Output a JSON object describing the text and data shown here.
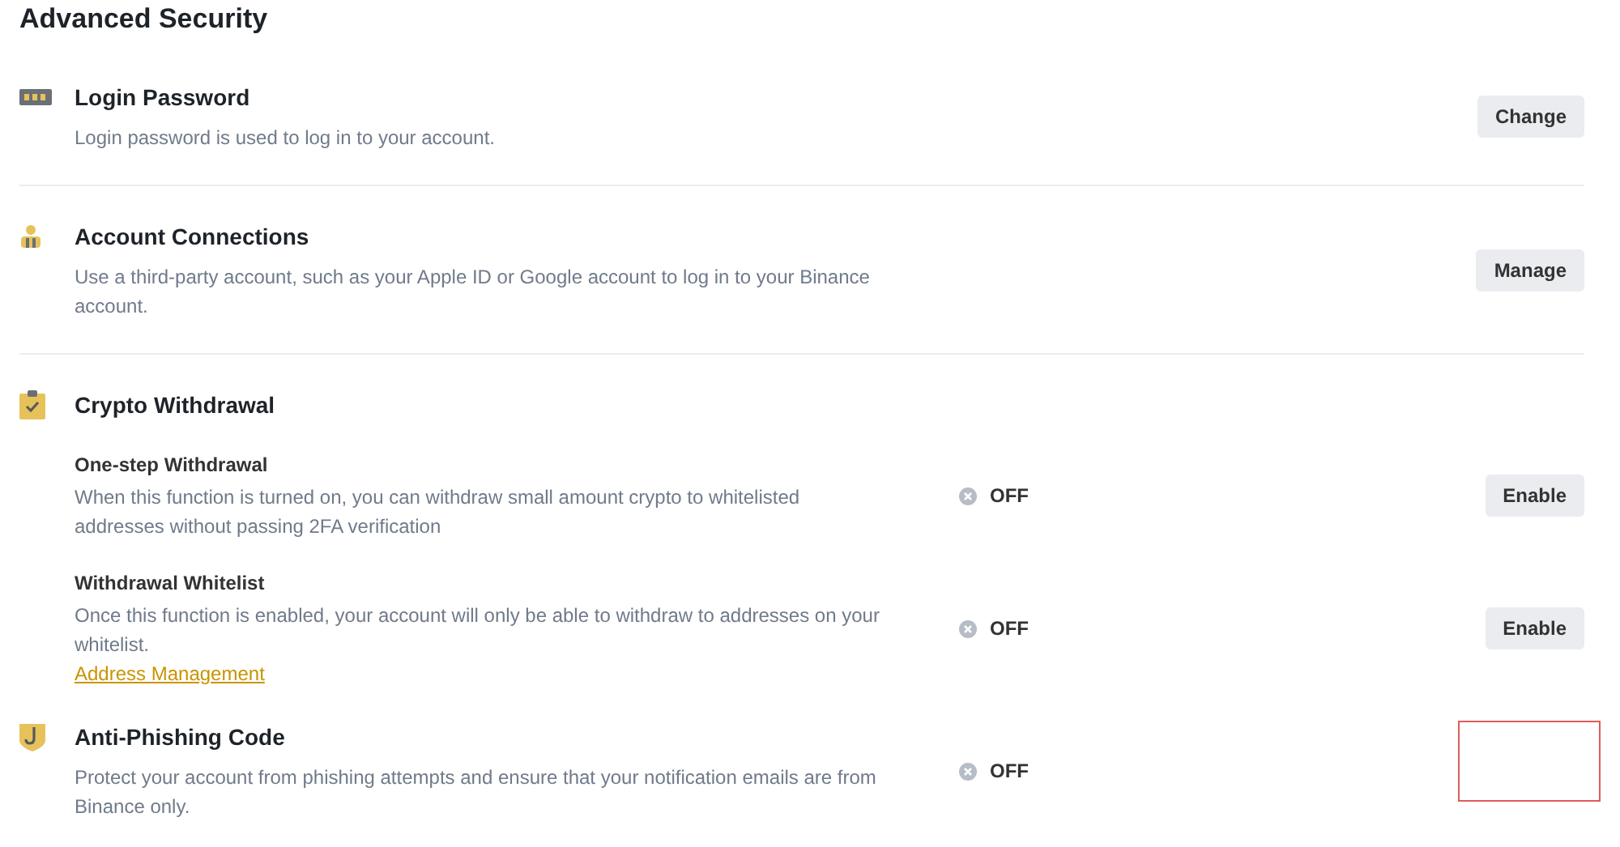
{
  "heading": "Advanced Security",
  "sections": [
    {
      "kind": "single",
      "title": "Login Password",
      "description": "Login password is used to log in to your account.",
      "button": "Change",
      "divider": true,
      "highlighted": false
    },
    {
      "kind": "single",
      "title": "Account Connections",
      "description": "Use a third-party account, such as your Apple ID or Google account to log in to your Binance account.",
      "button": "Manage",
      "divider": true,
      "highlighted": false
    },
    {
      "kind": "group",
      "title": "Crypto Withdrawal",
      "divider": false,
      "highlighted": false,
      "items": [
        {
          "title": "One-step Withdrawal",
          "description": "When this function is turned on, you can withdraw small amount crypto to whitelisted addresses without passing 2FA verification",
          "status": {
            "text": "OFF",
            "on": false
          },
          "button": "Enable"
        },
        {
          "title": "Withdrawal Whitelist",
          "description": "Once this function is enabled, your account will only be able to withdraw to addresses on your whitelist.",
          "link": "Address Management",
          "status": {
            "text": "OFF",
            "on": false
          },
          "button": "Enable"
        }
      ]
    },
    {
      "kind": "single",
      "title": "Anti-Phishing Code",
      "description": "Protect your account from phishing attempts and ensure that your notification emails are from Binance only.",
      "status": {
        "text": "OFF",
        "on": false
      },
      "divider": false,
      "highlighted": true
    }
  ]
}
